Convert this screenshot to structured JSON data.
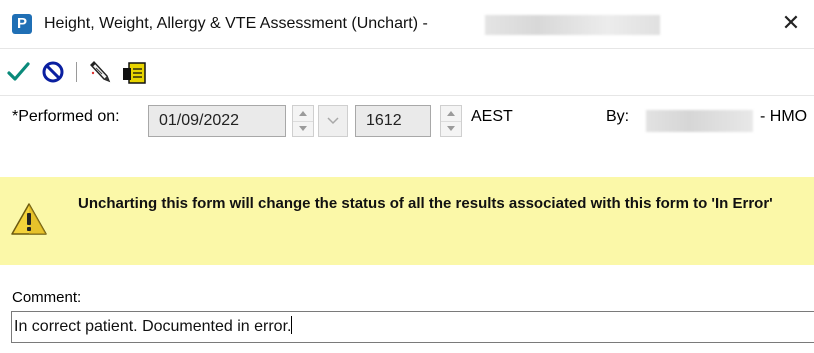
{
  "window": {
    "app_icon_letter": "P",
    "title": "Height, Weight, Allergy & VTE Assessment (Unchart) -",
    "close_glyph": "✕"
  },
  "toolbar": {
    "buttons": [
      {
        "name": "sign-check-icon",
        "color": "#0a8a7a"
      },
      {
        "name": "cancel-circle-icon",
        "color": "#0a1fa0"
      },
      {
        "name": "pencil-comment-icon"
      },
      {
        "name": "form-browser-icon",
        "color": "#e8d400"
      }
    ]
  },
  "performed": {
    "label": "*Performed on:",
    "date": "01/09/2022",
    "time": "1612",
    "timezone": "AEST",
    "by_label": "By:",
    "by_suffix": "- HMO"
  },
  "warning": {
    "message": "Uncharting this form will change the status of all the results associated with this form to 'In Error'",
    "background": "#fbf8a8"
  },
  "comment": {
    "label": "Comment:",
    "value": "In correct patient. Documented in error."
  }
}
